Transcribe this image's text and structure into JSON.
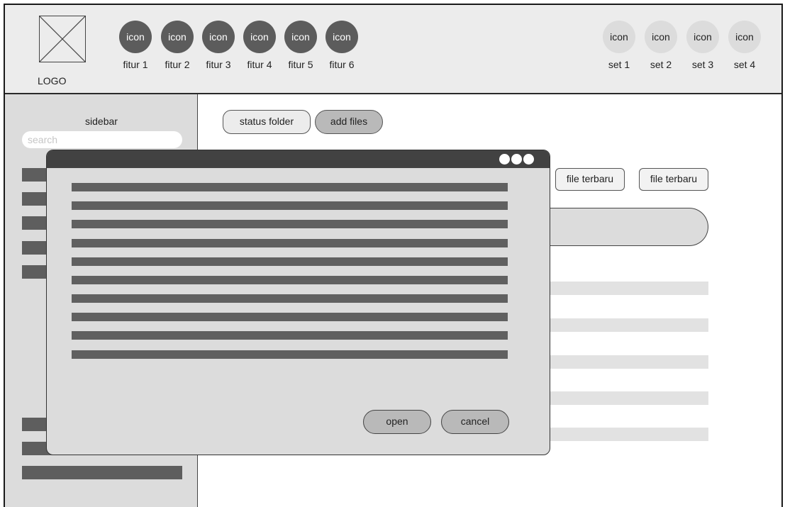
{
  "header": {
    "logo_label": "LOGO",
    "features": [
      {
        "icon": "icon",
        "label": "fitur 1"
      },
      {
        "icon": "icon",
        "label": "fitur 2"
      },
      {
        "icon": "icon",
        "label": "fitur 3"
      },
      {
        "icon": "icon",
        "label": "fitur 4"
      },
      {
        "icon": "icon",
        "label": "fitur 5"
      },
      {
        "icon": "icon",
        "label": "fitur 6"
      }
    ],
    "settings": [
      {
        "icon": "icon",
        "label": "set 1"
      },
      {
        "icon": "icon",
        "label": "set 2"
      },
      {
        "icon": "icon",
        "label": "set 3"
      },
      {
        "icon": "icon",
        "label": "set 4"
      }
    ]
  },
  "sidebar": {
    "title": "sidebar",
    "search_placeholder": "search"
  },
  "main": {
    "status_folder_label": "status folder",
    "add_files_label": "add files",
    "chips": [
      "file terbaru",
      "file terbaru"
    ]
  },
  "dialog": {
    "open_label": "open",
    "cancel_label": "cancel"
  },
  "colors": {
    "header_bg": "#ececec",
    "sidebar_bg": "#dcdcdc",
    "feature_icon": "#5c5c5c",
    "setting_icon": "#dcdcdc",
    "dialog_titlebar": "#424242"
  }
}
